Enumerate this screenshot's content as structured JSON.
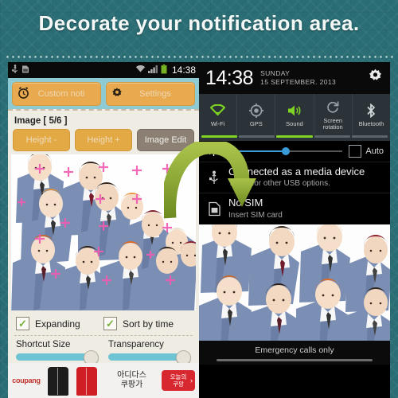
{
  "headline": "Decorate your notification area.",
  "theme": {
    "background_teal": "#2a6d74",
    "accent_orange": "#e8a94f",
    "bar_cyan": "#8ecad4",
    "toggle_on_green": "#7fd322",
    "brightness_blue": "#3a9bd9",
    "sparkle_pink": "#f05bb0"
  },
  "left_phone": {
    "status_bar": {
      "icons": [
        "usb-icon",
        "sd-card-icon"
      ],
      "right_icons": [
        "wifi-icon",
        "signal-icon",
        "battery-icon"
      ],
      "clock": "14:38"
    },
    "top_buttons": [
      {
        "label": "Custom noti",
        "icon": "alarm-clock-icon"
      },
      {
        "label": "Settings",
        "icon": "gear-icon"
      }
    ],
    "image_section": {
      "label": "Image  [ 5/6 ]",
      "buttons": [
        {
          "label": "Height -",
          "style": "orange"
        },
        {
          "label": "Height +",
          "style": "orange"
        },
        {
          "label": "Image Edit",
          "style": "dark"
        }
      ]
    },
    "checkboxes": [
      {
        "label": "Expanding",
        "checked": true
      },
      {
        "label": "Sort by time",
        "checked": true
      }
    ],
    "sliders": [
      {
        "label": "Shortcut Size",
        "value": 88
      },
      {
        "label": "Transparency",
        "value": 88
      }
    ],
    "ad_banner": {
      "logo": "coupang",
      "text_line1": "아디다스",
      "text_line2": "쿠팡가",
      "button_line1": "오늘의",
      "button_line2": "쿠팡",
      "arrow": "›"
    }
  },
  "right_phone": {
    "header": {
      "clock": "14:38",
      "day": "SUNDAY",
      "date": "15 SEPTEMBER. 2013",
      "gear_icon": "gear-icon"
    },
    "quick_toggles": [
      {
        "label": "Wi-Fi",
        "icon": "wifi-icon",
        "active": true
      },
      {
        "label": "GPS",
        "icon": "gps-icon",
        "active": false
      },
      {
        "label": "Sound",
        "icon": "sound-icon",
        "active": true
      },
      {
        "label": "Screen rotation",
        "icon": "rotation-icon",
        "active": false
      },
      {
        "label": "Bluetooth",
        "icon": "bluetooth-icon",
        "active": false
      }
    ],
    "brightness": {
      "icon": "brightness-icon",
      "value": 50,
      "auto_label": "Auto",
      "auto_checked": false
    },
    "notifications": [
      {
        "icon": "usb-icon",
        "title": "Connected as a media device",
        "subtitle": "Touch for other USB options."
      },
      {
        "icon": "sim-card-icon",
        "title": "No SIM",
        "subtitle": "Insert SIM card"
      }
    ],
    "footer": {
      "status": "Emergency calls only",
      "handle": "drag-handle"
    }
  }
}
